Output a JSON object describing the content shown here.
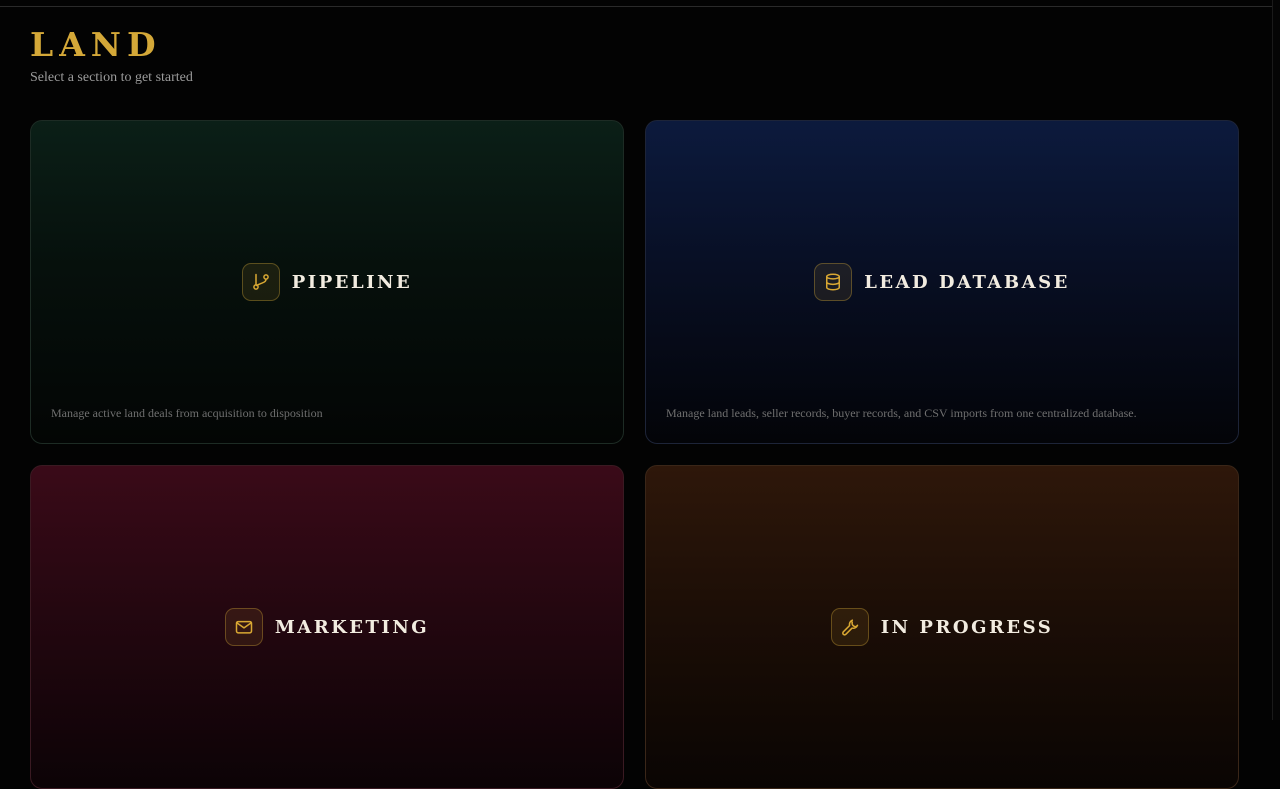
{
  "header": {
    "title": "LAND",
    "subtitle": "Select a section to get started"
  },
  "cards": [
    {
      "label": "PIPELINE",
      "icon": "git-branch-icon",
      "description": "Manage active land deals from acquisition to disposition"
    },
    {
      "label": "LEAD DATABASE",
      "icon": "database-icon",
      "description": "Manage land leads, seller records, buyer records, and CSV imports from one centralized database."
    },
    {
      "label": "MARKETING",
      "icon": "mail-icon",
      "description": ""
    },
    {
      "label": "IN PROGRESS",
      "icon": "wrench-icon",
      "description": ""
    }
  ],
  "colors": {
    "accent_gold": "#d4a838",
    "background": "#030303",
    "pipeline_tint": "#0b1f17",
    "lead_database_tint": "#0c1a3d",
    "marketing_tint": "#3a0a18",
    "in_progress_tint": "#2e170a"
  }
}
